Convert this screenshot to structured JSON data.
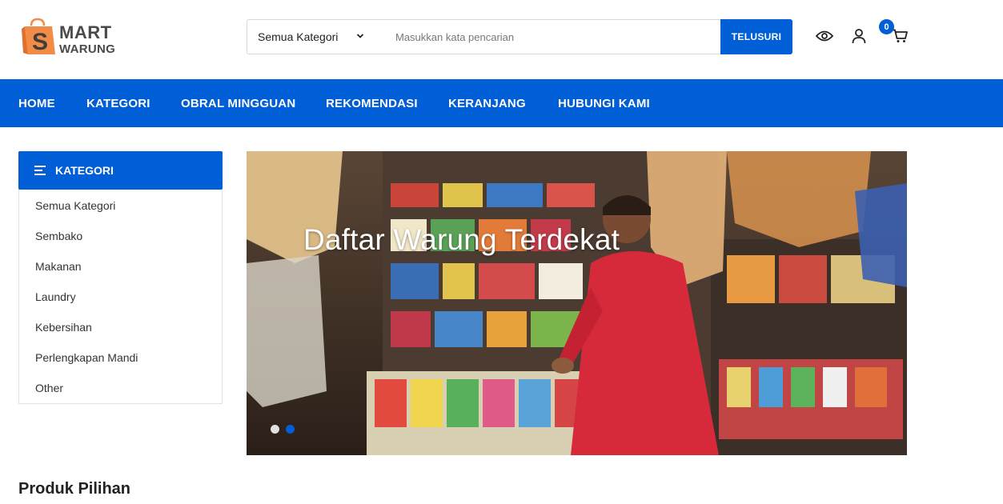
{
  "brand": {
    "name_line1": "MART",
    "name_line2": "WARUNG",
    "mark_letter": "S",
    "accent_color": "#f28b46"
  },
  "search": {
    "category_selected": "Semua Kategori",
    "placeholder": "Masukkan kata pencarian",
    "button_label": "TELUSURI"
  },
  "header_icons": {
    "view_icon": "eye-icon",
    "account_icon": "user-icon",
    "cart_icon": "cart-icon",
    "cart_count": "0"
  },
  "nav": {
    "items": [
      {
        "label": "HOME"
      },
      {
        "label": "KATEGORI"
      },
      {
        "label": "OBRAL MINGGUAN"
      },
      {
        "label": "REKOMENDASI"
      },
      {
        "label": "KERANJANG"
      },
      {
        "label": "HUBUNGI KAMI"
      }
    ]
  },
  "sidebar": {
    "title": "KATEGORI",
    "items": [
      {
        "label": "Semua Kategori"
      },
      {
        "label": "Sembako"
      },
      {
        "label": "Makanan"
      },
      {
        "label": "Laundry"
      },
      {
        "label": "Kebersihan"
      },
      {
        "label": "Perlengkapan Mandi"
      },
      {
        "label": "Other"
      }
    ]
  },
  "banner": {
    "title": "Daftar Warung Terdekat",
    "active_slide": 2,
    "slide_count": 2
  },
  "main": {
    "section_title": "Produk Pilihan"
  },
  "colors": {
    "primary": "#005ed6",
    "white": "#ffffff"
  }
}
